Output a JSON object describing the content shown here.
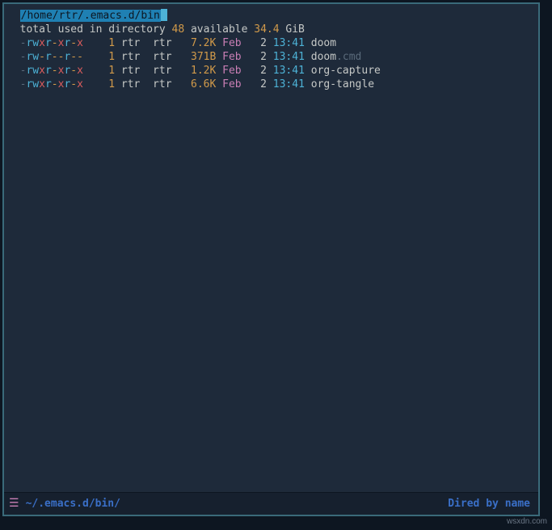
{
  "header": {
    "path": "/home/rtr/.emacs.d/bin"
  },
  "summary": {
    "prefix": "total used in directory ",
    "used": "48",
    "middle": " available ",
    "available": "34.4",
    "unit": " GiB"
  },
  "files": [
    {
      "perm_dash": "-",
      "perm_u": "rwx",
      "perm_g": "r-x",
      "perm_o": "r-x",
      "links": "1",
      "owner": "rtr",
      "group": "rtr",
      "size": "7.2K",
      "month": "Feb",
      "day": "2",
      "time": "13:41",
      "name": "doom",
      "ext": ""
    },
    {
      "perm_dash": "-",
      "perm_u": "rw-",
      "perm_g": "r--",
      "perm_o": "r--",
      "links": "1",
      "owner": "rtr",
      "group": "rtr",
      "size": "371B",
      "month": "Feb",
      "day": "2",
      "time": "13:41",
      "name": "doom",
      "ext": ".cmd"
    },
    {
      "perm_dash": "-",
      "perm_u": "rwx",
      "perm_g": "r-x",
      "perm_o": "r-x",
      "links": "1",
      "owner": "rtr",
      "group": "rtr",
      "size": "1.2K",
      "month": "Feb",
      "day": "2",
      "time": "13:41",
      "name": "org-capture",
      "ext": ""
    },
    {
      "perm_dash": "-",
      "perm_u": "rwx",
      "perm_g": "r-x",
      "perm_o": "r-x",
      "links": "1",
      "owner": "rtr",
      "group": "rtr",
      "size": "6.6K",
      "month": "Feb",
      "day": "2",
      "time": "13:41",
      "name": "org-tangle",
      "ext": ""
    }
  ],
  "modeline": {
    "path": "~/.emacs.d/bin/",
    "mode": "Dired by name"
  },
  "watermark": "wsxdn.com"
}
